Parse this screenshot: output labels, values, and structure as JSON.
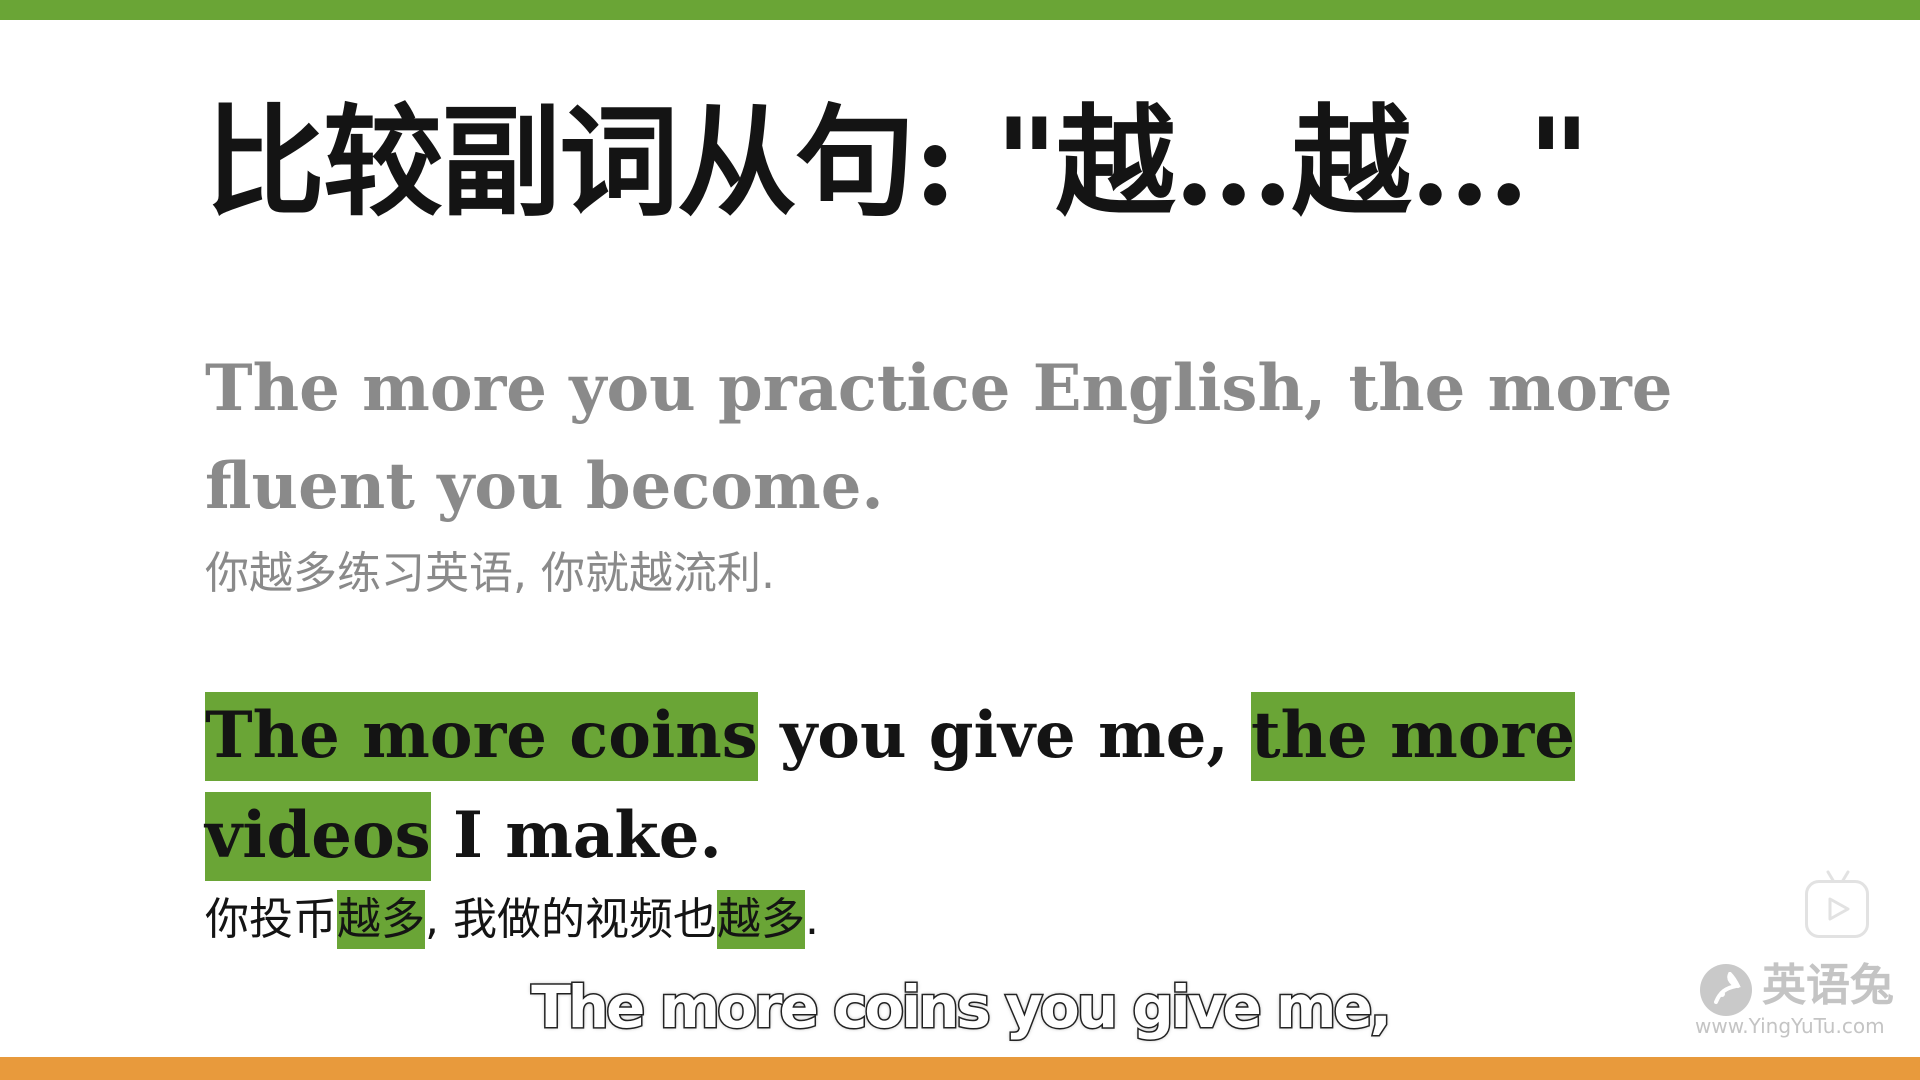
{
  "colors": {
    "accent_green": "#6aa536",
    "accent_orange": "#e89a3c",
    "title_text": "#141414",
    "muted_text": "#8a8a8a"
  },
  "slide": {
    "title": "比较副词从句: \"越…越…\"",
    "example1": {
      "en": "The more you practice English, the more fluent you become.",
      "cn": "你越多练习英语, 你就越流利."
    },
    "example2": {
      "en_highlight_1": "The more coins",
      "en_middle": " you give me, ",
      "en_highlight_2": "the more videos",
      "en_end": " I make.",
      "cn_1": "你投币",
      "cn_hl_1": "越多",
      "cn_2": ", 我做的视频也",
      "cn_hl_2": "越多",
      "cn_3": "."
    }
  },
  "subtitle": "The more coins you give me,",
  "player": {
    "icon": "play-icon"
  },
  "watermark": {
    "name": "英语兔",
    "url": "www.YingYuTu.com",
    "icon": "rabbit-logo-icon"
  }
}
